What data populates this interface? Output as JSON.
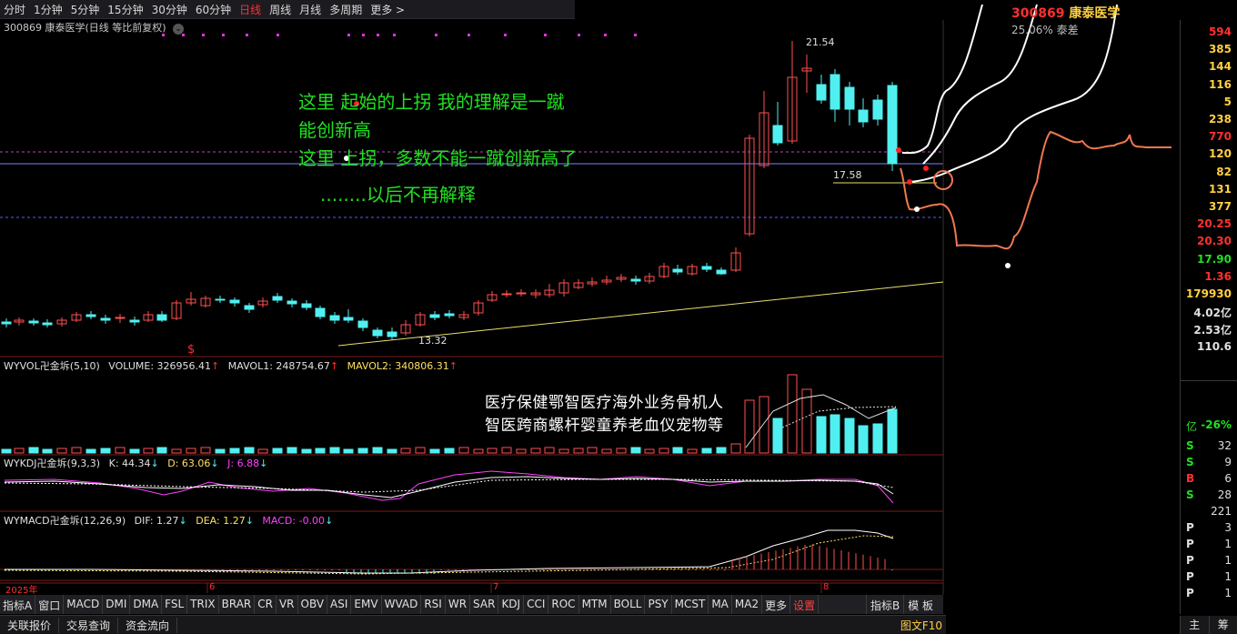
{
  "toolbar": {
    "periods": [
      "分时",
      "1分钟",
      "5分钟",
      "15分钟",
      "30分钟",
      "60分钟",
      "日线",
      "周线",
      "月线",
      "多周期",
      "更多 >"
    ],
    "active_index": 6
  },
  "chart_header": "300869 康泰医学(日线 等比前复权)",
  "annotations": {
    "line1": "这里   起始的上拐     我的理解是一蹴",
    "line2": "能创新高",
    "line3": "这里 上拐，多数不能一蹴创新高了",
    "line4": "........以后不再解释",
    "sector_line1": "医疗保健鄂智医疗海外业务骨机人",
    "sector_line2": "智医跨商螺杆婴童养老血仪宠物等"
  },
  "price_labels": {
    "high": "21.54",
    "mid": "17.58",
    "low": "13.32",
    "marker": "$"
  },
  "volume_header": {
    "name": "WYVOL卍金坼(5,10)",
    "volume": "VOLUME: 326956.41",
    "mavol1": "MAVOL1: 248754.67",
    "mavol2": "MAVOL2: 340806.31"
  },
  "kdj_header": {
    "name": "WYKDJ卍金坼(9,3,3)",
    "k": "K: 44.34",
    "d": "D: 63.06",
    "j": "J: 6.88"
  },
  "macd_header": {
    "name": "WYMACD卍金坼(12,26,9)",
    "dif": "DIF: 1.27",
    "dea": "DEA: 1.27",
    "macd": "MACD: -0.00"
  },
  "date_axis": [
    "2025年",
    "6",
    "7",
    "8"
  ],
  "overlay": {
    "title_code": "300869",
    "title_name": "康泰医学",
    "sub": "25.06%  泰差"
  },
  "info_panel": {
    "values": [
      {
        "text": "594",
        "color": "#ff3030"
      },
      {
        "text": "385",
        "color": "#ffd040"
      },
      {
        "text": "144",
        "color": "#ffd040"
      },
      {
        "text": "116",
        "color": "#ffd040"
      },
      {
        "text": "5",
        "color": "#ffd040"
      },
      {
        "text": "238",
        "color": "#ffd040"
      },
      {
        "text": "770",
        "color": "#ff3030"
      },
      {
        "text": "120",
        "color": "#ffd040"
      },
      {
        "text": "82",
        "color": "#ffd040"
      },
      {
        "text": "131",
        "color": "#ffd040"
      },
      {
        "text": "377",
        "color": "#ffd040"
      },
      {
        "text": "20.25",
        "color": "#ff3030"
      },
      {
        "text": "20.30",
        "color": "#ff3030"
      },
      {
        "text": "17.90",
        "color": "#20e020"
      },
      {
        "text": "1.36",
        "color": "#ff3030"
      },
      {
        "text": "179930",
        "color": "#ffd040"
      },
      {
        "text": "4.02亿",
        "color": "#e0e0e0"
      },
      {
        "text": "2.53亿",
        "color": "#e0e0e0"
      },
      {
        "text": "110.6",
        "color": "#e0e0e0"
      }
    ],
    "change": {
      "k": "亿",
      "v": "-26%"
    },
    "rows": [
      {
        "k": "S",
        "v": "32",
        "color": "#20e020"
      },
      {
        "k": "S",
        "v": "9",
        "color": "#20e020"
      },
      {
        "k": "B",
        "v": "6",
        "color": "#ff3030"
      },
      {
        "k": "S",
        "v": "28",
        "color": "#20e020"
      },
      {
        "k": "",
        "v": "221",
        "color": "#e0e0e0"
      },
      {
        "k": "P",
        "v": "3",
        "color": "#e0e0e0"
      },
      {
        "k": "P",
        "v": "1",
        "color": "#e0e0e0"
      },
      {
        "k": "P",
        "v": "1",
        "color": "#e0e0e0"
      },
      {
        "k": "P",
        "v": "1",
        "color": "#e0e0e0"
      },
      {
        "k": "P",
        "v": "1",
        "color": "#e0e0e0"
      }
    ]
  },
  "indicator_tabs": [
    "指标A",
    "窗口",
    "MACD",
    "DMI",
    "DMA",
    "FSL",
    "TRIX",
    "BRAR",
    "CR",
    "VR",
    "OBV",
    "ASI",
    "EMV",
    "WVAD",
    "RSI",
    "WR",
    "SAR",
    "KDJ",
    "CCI",
    "ROC",
    "MTM",
    "BOLL",
    "PSY",
    "MCST",
    "MA",
    "MA2",
    "更多",
    "设置"
  ],
  "indicator_right": [
    "指标B",
    "模 板"
  ],
  "bottom_tabs": [
    "关联报价",
    "交易查询",
    "资金流向"
  ],
  "bottom_right": "图文F10",
  "panel_bottom": [
    "主",
    "筹"
  ]
}
